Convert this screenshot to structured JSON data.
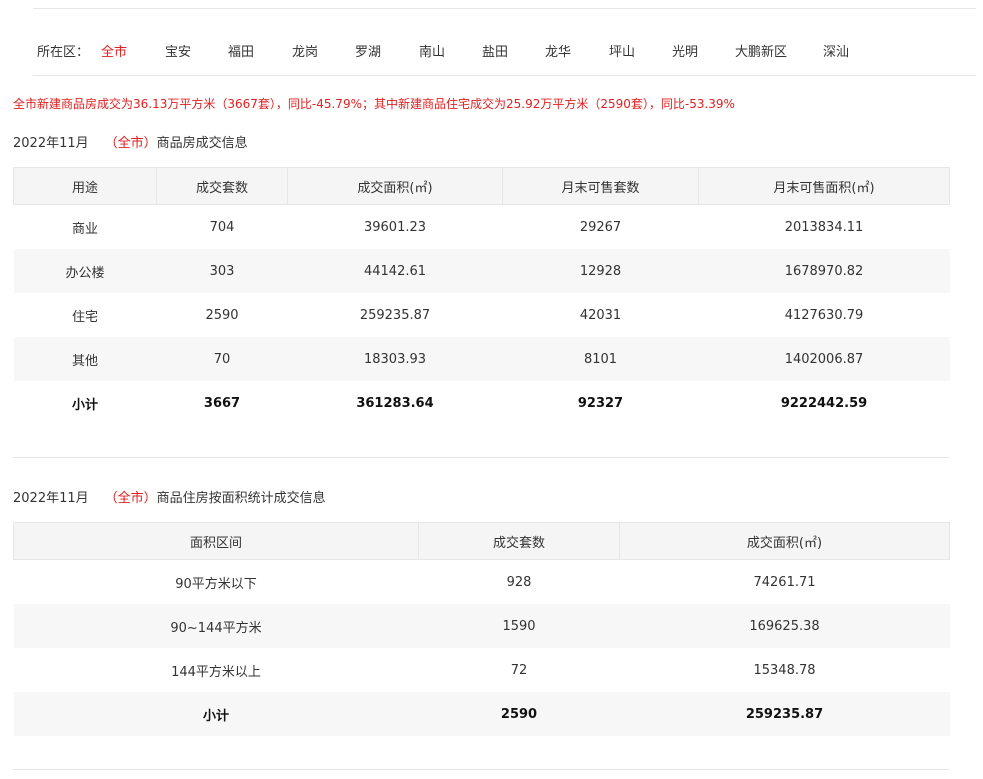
{
  "districts": {
    "label": "所在区：",
    "items": [
      "全市",
      "宝安",
      "福田",
      "龙岗",
      "罗湖",
      "南山",
      "盐田",
      "龙华",
      "坪山",
      "光明",
      "大鹏新区",
      "深汕"
    ],
    "active_index": 0
  },
  "summary": "全市新建商品房成交为36.13万平方米（3667套），同比-45.79%；其中新建商品住宅成交为25.92万平方米（2590套），同比-53.39%",
  "section1": {
    "period": "2022年11月",
    "region": "（全市）",
    "title": "商品房成交信息",
    "headers": [
      "用途",
      "成交套数",
      "成交面积(㎡)",
      "月末可售套数",
      "月末可售面积(㎡)"
    ],
    "rows": [
      [
        "商业",
        "704",
        "39601.23",
        "29267",
        "2013834.11"
      ],
      [
        "办公楼",
        "303",
        "44142.61",
        "12928",
        "1678970.82"
      ],
      [
        "住宅",
        "2590",
        "259235.87",
        "42031",
        "4127630.79"
      ],
      [
        "其他",
        "70",
        "18303.93",
        "8101",
        "1402006.87"
      ]
    ],
    "total": [
      "小计",
      "3667",
      "361283.64",
      "92327",
      "9222442.59"
    ]
  },
  "section2": {
    "period": "2022年11月",
    "region": "（全市）",
    "title": "商品住房按面积统计成交信息",
    "headers": [
      "面积区间",
      "成交套数",
      "成交面积(㎡)"
    ],
    "rows": [
      [
        "90平方米以下",
        "928",
        "74261.71"
      ],
      [
        "90~144平方米",
        "1590",
        "169625.38"
      ],
      [
        "144平方米以上",
        "72",
        "15348.78"
      ]
    ],
    "total": [
      "小计",
      "2590",
      "259235.87"
    ]
  },
  "colors": {
    "accent": "#e02020",
    "header_bg": "#f5f5f5",
    "stripe_bg": "#f7f7f7"
  }
}
